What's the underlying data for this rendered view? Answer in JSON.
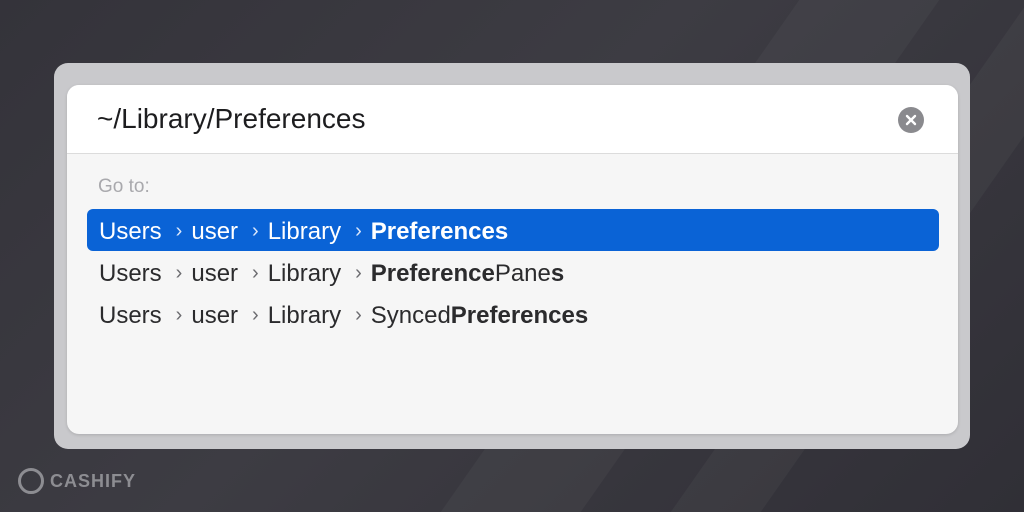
{
  "search": {
    "value": "~/Library/Preferences"
  },
  "icons": {
    "clear": "clear-x-circle-icon",
    "chevron": "chevron-right-icon"
  },
  "goto_label": "Go to:",
  "results": [
    {
      "crumbs": [
        "Users",
        "user",
        "Library"
      ],
      "last": {
        "plain_before": "",
        "bold": "Preferences",
        "plain_after": "",
        "bold_tail": ""
      },
      "selected": true
    },
    {
      "crumbs": [
        "Users",
        "user",
        "Library"
      ],
      "last": {
        "plain_before": "",
        "bold": "Preference",
        "plain_after": "Pane",
        "bold_tail": "s"
      },
      "selected": false
    },
    {
      "crumbs": [
        "Users",
        "user",
        "Library"
      ],
      "last": {
        "plain_before": "Synced",
        "bold": "Preferences",
        "plain_after": "",
        "bold_tail": ""
      },
      "selected": false
    }
  ],
  "separator": "›",
  "watermark": "CASHIFY",
  "colors": {
    "selection": "#0a63d6",
    "panel": "#f6f6f6",
    "clear_button": "#8a8a8e"
  }
}
